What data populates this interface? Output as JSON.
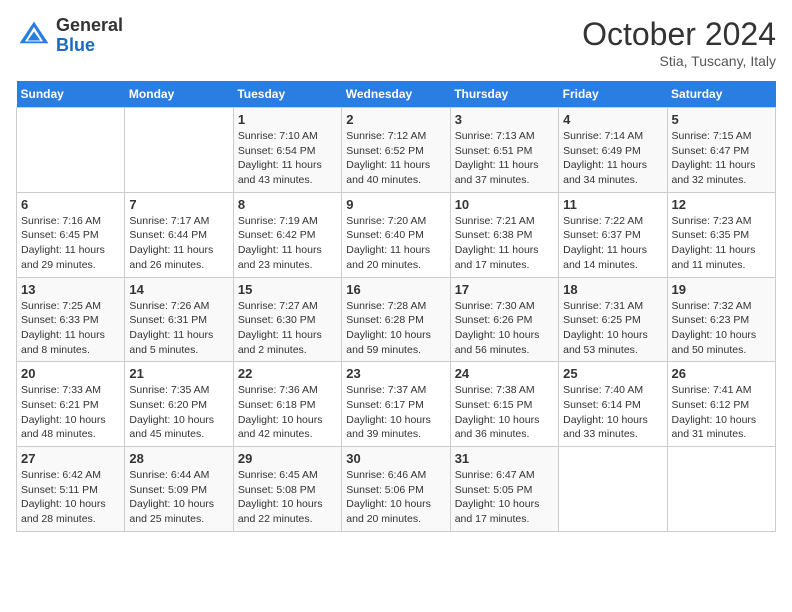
{
  "header": {
    "logo_line1": "General",
    "logo_line2": "Blue",
    "month": "October 2024",
    "location": "Stia, Tuscany, Italy"
  },
  "weekdays": [
    "Sunday",
    "Monday",
    "Tuesday",
    "Wednesday",
    "Thursday",
    "Friday",
    "Saturday"
  ],
  "weeks": [
    [
      {
        "day": "",
        "content": ""
      },
      {
        "day": "",
        "content": ""
      },
      {
        "day": "1",
        "content": "Sunrise: 7:10 AM\nSunset: 6:54 PM\nDaylight: 11 hours and 43 minutes."
      },
      {
        "day": "2",
        "content": "Sunrise: 7:12 AM\nSunset: 6:52 PM\nDaylight: 11 hours and 40 minutes."
      },
      {
        "day": "3",
        "content": "Sunrise: 7:13 AM\nSunset: 6:51 PM\nDaylight: 11 hours and 37 minutes."
      },
      {
        "day": "4",
        "content": "Sunrise: 7:14 AM\nSunset: 6:49 PM\nDaylight: 11 hours and 34 minutes."
      },
      {
        "day": "5",
        "content": "Sunrise: 7:15 AM\nSunset: 6:47 PM\nDaylight: 11 hours and 32 minutes."
      }
    ],
    [
      {
        "day": "6",
        "content": "Sunrise: 7:16 AM\nSunset: 6:45 PM\nDaylight: 11 hours and 29 minutes."
      },
      {
        "day": "7",
        "content": "Sunrise: 7:17 AM\nSunset: 6:44 PM\nDaylight: 11 hours and 26 minutes."
      },
      {
        "day": "8",
        "content": "Sunrise: 7:19 AM\nSunset: 6:42 PM\nDaylight: 11 hours and 23 minutes."
      },
      {
        "day": "9",
        "content": "Sunrise: 7:20 AM\nSunset: 6:40 PM\nDaylight: 11 hours and 20 minutes."
      },
      {
        "day": "10",
        "content": "Sunrise: 7:21 AM\nSunset: 6:38 PM\nDaylight: 11 hours and 17 minutes."
      },
      {
        "day": "11",
        "content": "Sunrise: 7:22 AM\nSunset: 6:37 PM\nDaylight: 11 hours and 14 minutes."
      },
      {
        "day": "12",
        "content": "Sunrise: 7:23 AM\nSunset: 6:35 PM\nDaylight: 11 hours and 11 minutes."
      }
    ],
    [
      {
        "day": "13",
        "content": "Sunrise: 7:25 AM\nSunset: 6:33 PM\nDaylight: 11 hours and 8 minutes."
      },
      {
        "day": "14",
        "content": "Sunrise: 7:26 AM\nSunset: 6:31 PM\nDaylight: 11 hours and 5 minutes."
      },
      {
        "day": "15",
        "content": "Sunrise: 7:27 AM\nSunset: 6:30 PM\nDaylight: 11 hours and 2 minutes."
      },
      {
        "day": "16",
        "content": "Sunrise: 7:28 AM\nSunset: 6:28 PM\nDaylight: 10 hours and 59 minutes."
      },
      {
        "day": "17",
        "content": "Sunrise: 7:30 AM\nSunset: 6:26 PM\nDaylight: 10 hours and 56 minutes."
      },
      {
        "day": "18",
        "content": "Sunrise: 7:31 AM\nSunset: 6:25 PM\nDaylight: 10 hours and 53 minutes."
      },
      {
        "day": "19",
        "content": "Sunrise: 7:32 AM\nSunset: 6:23 PM\nDaylight: 10 hours and 50 minutes."
      }
    ],
    [
      {
        "day": "20",
        "content": "Sunrise: 7:33 AM\nSunset: 6:21 PM\nDaylight: 10 hours and 48 minutes."
      },
      {
        "day": "21",
        "content": "Sunrise: 7:35 AM\nSunset: 6:20 PM\nDaylight: 10 hours and 45 minutes."
      },
      {
        "day": "22",
        "content": "Sunrise: 7:36 AM\nSunset: 6:18 PM\nDaylight: 10 hours and 42 minutes."
      },
      {
        "day": "23",
        "content": "Sunrise: 7:37 AM\nSunset: 6:17 PM\nDaylight: 10 hours and 39 minutes."
      },
      {
        "day": "24",
        "content": "Sunrise: 7:38 AM\nSunset: 6:15 PM\nDaylight: 10 hours and 36 minutes."
      },
      {
        "day": "25",
        "content": "Sunrise: 7:40 AM\nSunset: 6:14 PM\nDaylight: 10 hours and 33 minutes."
      },
      {
        "day": "26",
        "content": "Sunrise: 7:41 AM\nSunset: 6:12 PM\nDaylight: 10 hours and 31 minutes."
      }
    ],
    [
      {
        "day": "27",
        "content": "Sunrise: 6:42 AM\nSunset: 5:11 PM\nDaylight: 10 hours and 28 minutes."
      },
      {
        "day": "28",
        "content": "Sunrise: 6:44 AM\nSunset: 5:09 PM\nDaylight: 10 hours and 25 minutes."
      },
      {
        "day": "29",
        "content": "Sunrise: 6:45 AM\nSunset: 5:08 PM\nDaylight: 10 hours and 22 minutes."
      },
      {
        "day": "30",
        "content": "Sunrise: 6:46 AM\nSunset: 5:06 PM\nDaylight: 10 hours and 20 minutes."
      },
      {
        "day": "31",
        "content": "Sunrise: 6:47 AM\nSunset: 5:05 PM\nDaylight: 10 hours and 17 minutes."
      },
      {
        "day": "",
        "content": ""
      },
      {
        "day": "",
        "content": ""
      }
    ]
  ]
}
